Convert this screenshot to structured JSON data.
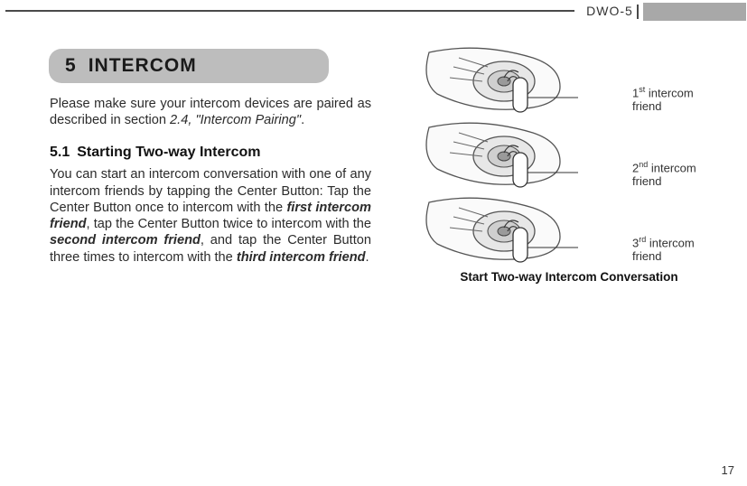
{
  "header": {
    "product": "DWO-5"
  },
  "chapter": {
    "number": "5",
    "title": "INTERCOM"
  },
  "intro": {
    "pre": "Please make sure your intercom devices are paired as described in section ",
    "ref": "2.4, \"Intercom Pairing\"",
    "post": "."
  },
  "section": {
    "number": "5.1",
    "title": "Starting Two-way Intercom"
  },
  "body": {
    "p1a": "You can start an intercom conversation with one of any intercom friends by tapping the Center Button: Tap the Center Button once to intercom with the ",
    "b1": "first intercom friend",
    "p1b": ", tap the Center Button twice to intercom with the ",
    "b2": "second intercom friend",
    "p1c": ", and tap the Center Button three times to intercom with the ",
    "b3": "third intercom friend",
    "p1d": "."
  },
  "figure": {
    "items": [
      {
        "ord": "1",
        "sup": "st",
        "label": " intercom friend"
      },
      {
        "ord": "2",
        "sup": "nd",
        "label": " intercom friend"
      },
      {
        "ord": "3",
        "sup": "rd",
        "label": " intercom friend"
      }
    ],
    "caption": "Start Two-way Intercom Conversation"
  },
  "page": {
    "number": "17"
  }
}
